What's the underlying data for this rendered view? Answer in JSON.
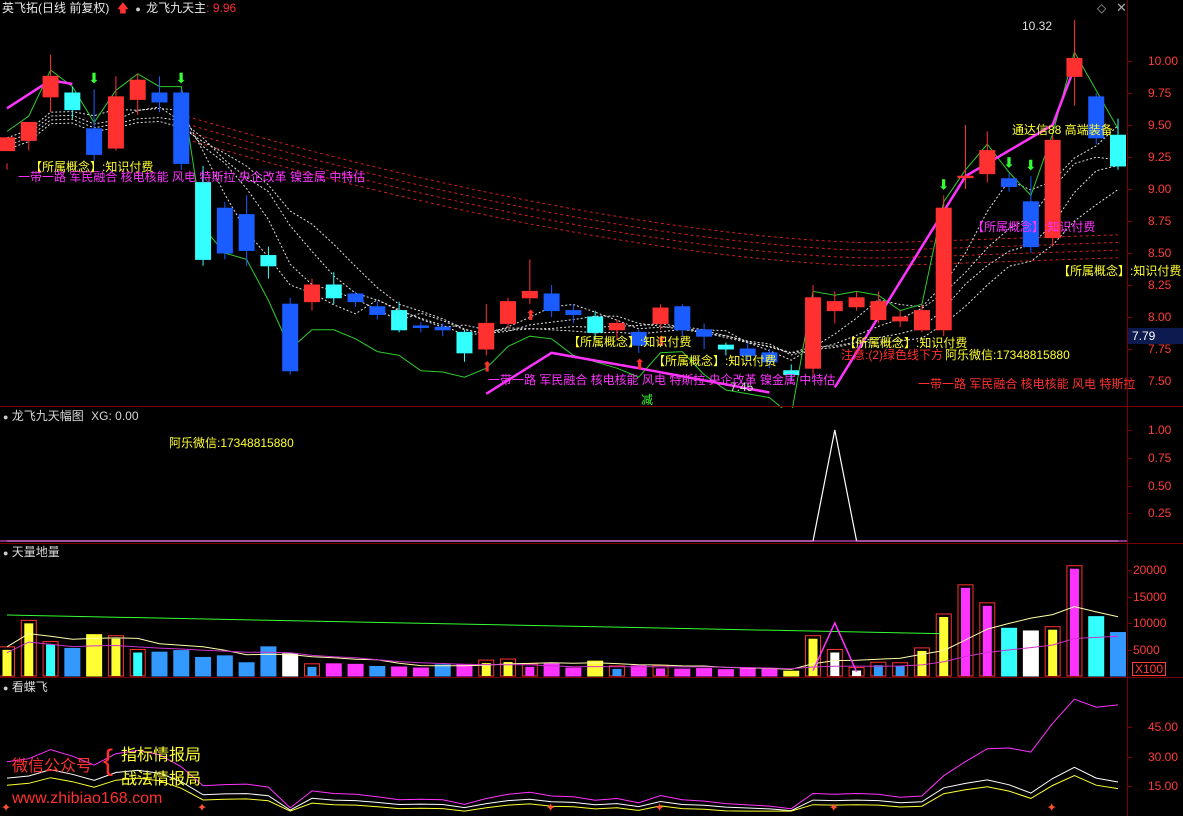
{
  "header": {
    "stock": "英飞拓",
    "mode": "(日线 前复权)",
    "indicator": "龙飞九天主",
    "indicator_value": ": 9.96",
    "colors": {
      "up": "#ff3030",
      "down": "#33ffff",
      "magenta": "#ff33ff",
      "yellow": "#ffff33"
    }
  },
  "main": {
    "high_label": "10.32",
    "low_label": "7.45",
    "last_price": "7.79",
    "ticks": [
      "10.00",
      "9.75",
      "9.50",
      "9.25",
      "9.00",
      "8.75",
      "8.50",
      "8.25",
      "8.00",
      "7.75",
      "7.50"
    ],
    "annotations": [
      {
        "text": "【所属概念】:知识付费",
        "color": "#ffff33"
      },
      {
        "text": "一带一路 军民融合 核电核能 风电 特斯拉 央企改革 镍金属 中特估",
        "color": "#ff33ff"
      },
      {
        "text": "【所属概念】:知识付费",
        "color": "#ffff33"
      },
      {
        "text": "一带一路 军民融合 核电核能 风电 特斯拉 央企改革 镍金属 中特估",
        "color": "#ff33ff"
      },
      {
        "text": "【所属概念】:知识付费",
        "color": "#ffff33"
      },
      {
        "text": "通达信88 高端装备",
        "color": "#ffff33"
      },
      {
        "text": "【所属概念】:知识付费",
        "color": "#ff33ff"
      },
      {
        "text": "注意:(2)绿色线下方",
        "color": "#ff3030"
      },
      {
        "text": "阿乐微信:17348815880",
        "color": "#ffff33"
      },
      {
        "text": "一带一路 军民融合 核电核能 风电 特斯拉",
        "color": "#ff3030"
      },
      {
        "text": "【所属概念】:知识付费",
        "color": "#ffff33"
      },
      {
        "text": "【所属概念】:知识付费",
        "color": "#ffff33"
      },
      {
        "text": "减",
        "color": "#33ff33"
      }
    ]
  },
  "panel2": {
    "title": "龙飞九天幅图",
    "xg": "XG: 0.00",
    "wechat": "阿乐微信:17348815880",
    "ticks": [
      "1.00",
      "0.75",
      "0.50",
      "0.25"
    ]
  },
  "panel3": {
    "title": "天量地量",
    "ticks": [
      "20000",
      "15000",
      "10000",
      "5000"
    ],
    "unit": "X100"
  },
  "panel4": {
    "title": "看蝶飞",
    "ticks": [
      "45.00",
      "30.00",
      "15.00"
    ],
    "wm1": "微信公众号",
    "wm2": "指标情报局",
    "wm3": "战法情报局",
    "wm4": "www.zhibiao168.com"
  },
  "chart_data": {
    "type": "candlestick",
    "ylim": [
      7.35,
      10.45
    ],
    "candles": [
      [
        9.3,
        9.4,
        9.2,
        9.15
      ],
      [
        9.38,
        9.52,
        9.4,
        9.3
      ],
      [
        9.72,
        9.88,
        10.05,
        9.6
      ],
      [
        9.75,
        9.62,
        9.8,
        9.55
      ],
      [
        9.47,
        9.27,
        9.78,
        9.22
      ],
      [
        9.32,
        9.72,
        9.88,
        9.3
      ],
      [
        9.7,
        9.85,
        9.9,
        9.58
      ],
      [
        9.75,
        9.68,
        9.88,
        9.6
      ],
      [
        9.75,
        9.2,
        9.78,
        9.15
      ],
      [
        9.05,
        8.45,
        9.18,
        8.4
      ],
      [
        8.85,
        8.5,
        8.9,
        8.45
      ],
      [
        8.8,
        8.52,
        8.95,
        8.4
      ],
      [
        8.48,
        8.4,
        8.55,
        8.3
      ],
      [
        8.1,
        7.58,
        8.15,
        7.55
      ],
      [
        8.12,
        8.25,
        8.3,
        8.05
      ],
      [
        8.25,
        8.15,
        8.35,
        8.1
      ],
      [
        8.18,
        8.12,
        8.2,
        8.08
      ],
      [
        8.08,
        8.02,
        8.12,
        7.98
      ],
      [
        8.05,
        7.9,
        8.12,
        7.88
      ],
      [
        7.93,
        7.92,
        7.96,
        7.88
      ],
      [
        7.92,
        7.9,
        7.95,
        7.85
      ],
      [
        7.88,
        7.72,
        7.9,
        7.65
      ],
      [
        7.75,
        7.95,
        8.1,
        7.7
      ],
      [
        7.95,
        8.12,
        8.15,
        7.92
      ],
      [
        8.15,
        8.2,
        8.45,
        8.1
      ],
      [
        8.18,
        8.05,
        8.25,
        8.0
      ],
      [
        8.05,
        8.02,
        8.1,
        7.95
      ],
      [
        8.0,
        7.88,
        8.05,
        7.82
      ],
      [
        7.9,
        7.95,
        7.98,
        7.82
      ],
      [
        7.88,
        7.78,
        7.9,
        7.72
      ],
      [
        7.95,
        8.07,
        8.1,
        7.9
      ],
      [
        8.08,
        7.9,
        8.1,
        7.85
      ],
      [
        7.9,
        7.85,
        7.95,
        7.75
      ],
      [
        7.78,
        7.75,
        7.8,
        7.7
      ],
      [
        7.75,
        7.7,
        7.8,
        7.65
      ],
      [
        7.72,
        7.65,
        7.75,
        7.6
      ],
      [
        7.58,
        7.55,
        7.63,
        7.5
      ],
      [
        7.6,
        8.15,
        8.25,
        7.55
      ],
      [
        8.05,
        8.12,
        8.2,
        7.95
      ],
      [
        8.08,
        8.15,
        8.2,
        8.05
      ],
      [
        7.98,
        8.12,
        8.2,
        7.95
      ],
      [
        7.97,
        8.0,
        8.05,
        7.92
      ],
      [
        7.9,
        8.05,
        8.1,
        7.88
      ],
      [
        7.9,
        8.85,
        8.95,
        7.85
      ],
      [
        9.1,
        9.1,
        9.5,
        9.0
      ],
      [
        9.12,
        9.3,
        9.45,
        9.05
      ],
      [
        9.08,
        9.02,
        9.12,
        8.98
      ],
      [
        8.9,
        8.55,
        9.1,
        8.5
      ],
      [
        8.62,
        9.38,
        9.42,
        8.55
      ],
      [
        9.88,
        10.02,
        10.32,
        9.65
      ],
      [
        9.72,
        9.4,
        9.75,
        9.35
      ],
      [
        9.42,
        9.18,
        9.55,
        9.15
      ]
    ],
    "volume": [
      [
        5500,
        "y"
      ],
      [
        10500,
        "y"
      ],
      [
        6500,
        "c"
      ],
      [
        5200,
        "b"
      ],
      [
        7800,
        "y"
      ],
      [
        7600,
        "y"
      ],
      [
        5000,
        "c"
      ],
      [
        4500,
        "b"
      ],
      [
        4800,
        "b"
      ],
      [
        3500,
        "b"
      ],
      [
        3800,
        "b"
      ],
      [
        2500,
        "b"
      ],
      [
        5500,
        "b"
      ],
      [
        4200,
        "w"
      ],
      [
        2300,
        "b"
      ],
      [
        2300,
        "m"
      ],
      [
        2200,
        "m"
      ],
      [
        1800,
        "b"
      ],
      [
        1700,
        "m"
      ],
      [
        1500,
        "m"
      ],
      [
        2100,
        "b"
      ],
      [
        2200,
        "m"
      ],
      [
        3000,
        "y"
      ],
      [
        3200,
        "y"
      ],
      [
        2300,
        "m"
      ],
      [
        2300,
        "m"
      ],
      [
        1500,
        "m"
      ],
      [
        2800,
        "y"
      ],
      [
        1900,
        "b"
      ],
      [
        1900,
        "m"
      ],
      [
        2000,
        "m"
      ],
      [
        1300,
        "m"
      ],
      [
        1400,
        "m"
      ],
      [
        1200,
        "m"
      ],
      [
        1400,
        "m"
      ],
      [
        1300,
        "m"
      ],
      [
        900,
        "y"
      ],
      [
        7600,
        "y"
      ],
      [
        5000,
        "w"
      ],
      [
        1600,
        "w"
      ],
      [
        2600,
        "b"
      ],
      [
        2500,
        "b"
      ],
      [
        5300,
        "y"
      ],
      [
        11700,
        "y"
      ],
      [
        17200,
        "m"
      ],
      [
        13800,
        "m"
      ],
      [
        9000,
        "c"
      ],
      [
        8500,
        "w"
      ],
      [
        9300,
        "y"
      ],
      [
        20800,
        "m"
      ],
      [
        11200,
        "c"
      ],
      [
        8200,
        "b"
      ]
    ],
    "xg": [
      0,
      0,
      0,
      0,
      0,
      0,
      0,
      0,
      0,
      0,
      0,
      0,
      0,
      0,
      0,
      0,
      0,
      0,
      0,
      0,
      0,
      0,
      0,
      0,
      0,
      0,
      0,
      0,
      0,
      0,
      0,
      0,
      0,
      0,
      0,
      0,
      0,
      0,
      1,
      0,
      0,
      0,
      0,
      0,
      0,
      0,
      0,
      0,
      0,
      0,
      0,
      0
    ]
  }
}
